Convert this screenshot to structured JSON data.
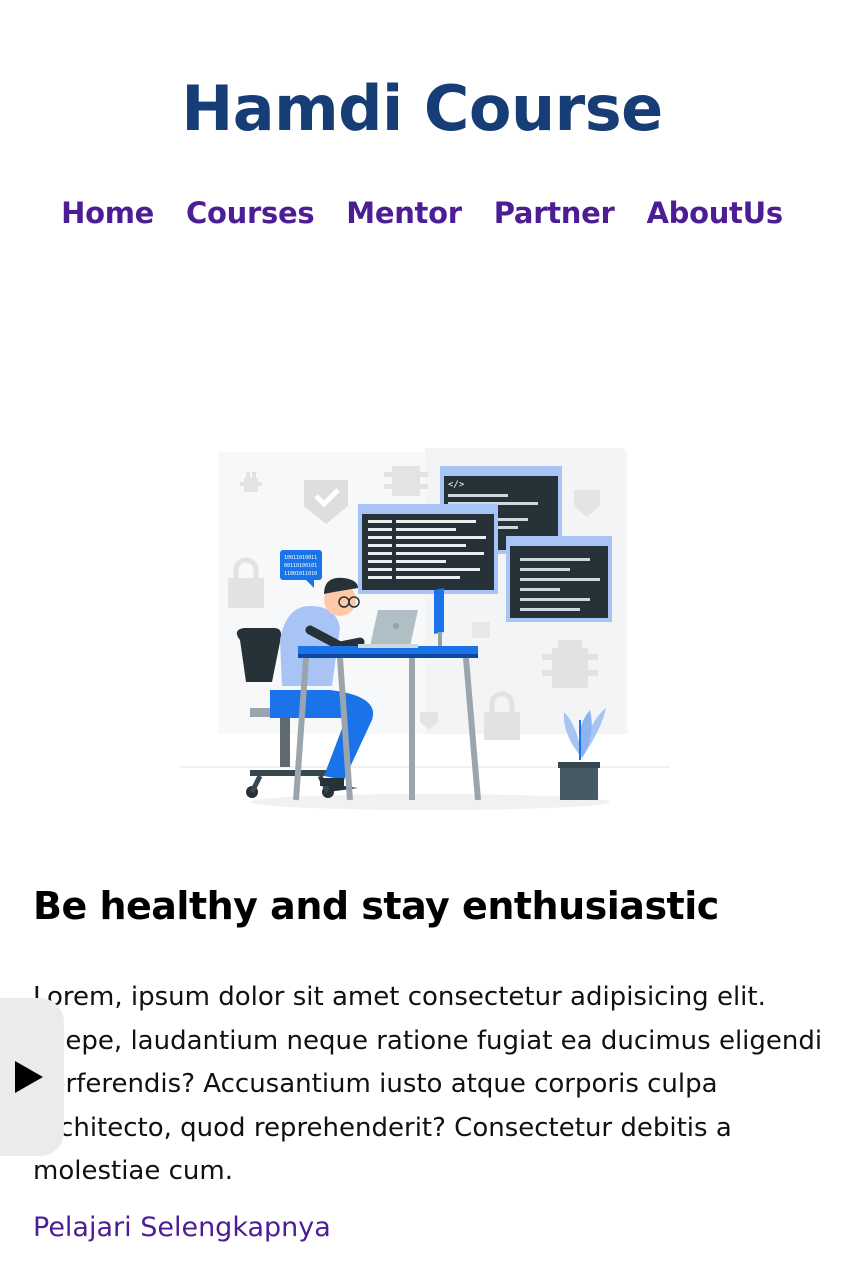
{
  "header": {
    "brand": "Hamdi Course"
  },
  "nav": {
    "items": [
      {
        "label": "Home"
      },
      {
        "label": "Courses"
      },
      {
        "label": "Mentor"
      },
      {
        "label": "Partner"
      },
      {
        "label": "AboutUs"
      }
    ]
  },
  "hero": {
    "illustration_icon": "developer-at-desk-illustration",
    "bubble_code": [
      "10011010011",
      "00110100101",
      "11001011010"
    ],
    "code_window_tag": "</>"
  },
  "content": {
    "headline": "Be healthy and stay enthusiastic",
    "paragraph": "Lorem, ipsum dolor sit amet consectetur adipisicing elit. Saepe, laudantium neque ratione fugiat ea ducimus eligendi perferendis? Accusantium iusto atque corporis culpa architecto, quod reprehenderit? Consectetur debitis a molestiae cum.",
    "link_label": "Pelajari Selengkapnya"
  },
  "overlay": {
    "play_icon": "play-icon"
  },
  "colors": {
    "brand": "#163d75",
    "nav": "#4c1d95",
    "accent_blue": "#1a73e8"
  }
}
